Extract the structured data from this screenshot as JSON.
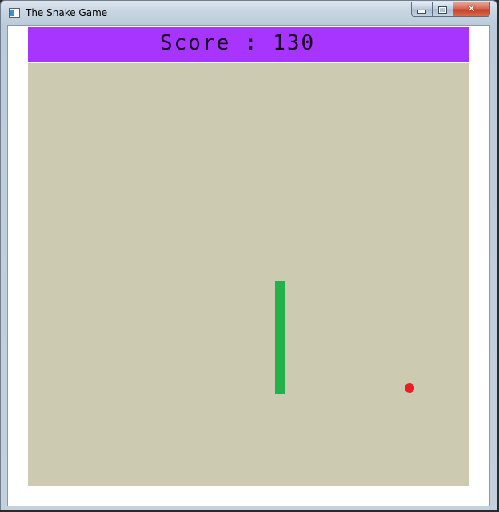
{
  "window": {
    "title": "The Snake Game",
    "icon": "app-window-icon",
    "controls": {
      "minimize_icon": "minimize-icon",
      "maximize_icon": "maximize-icon",
      "close_icon": "close-icon",
      "close_glyph": "✕"
    }
  },
  "game": {
    "score_text": "Score : 130",
    "colors": {
      "scorebar": "#a834ff",
      "board": "#cccbb1",
      "snake": "#22b14c",
      "food": "#ed1c24"
    }
  }
}
